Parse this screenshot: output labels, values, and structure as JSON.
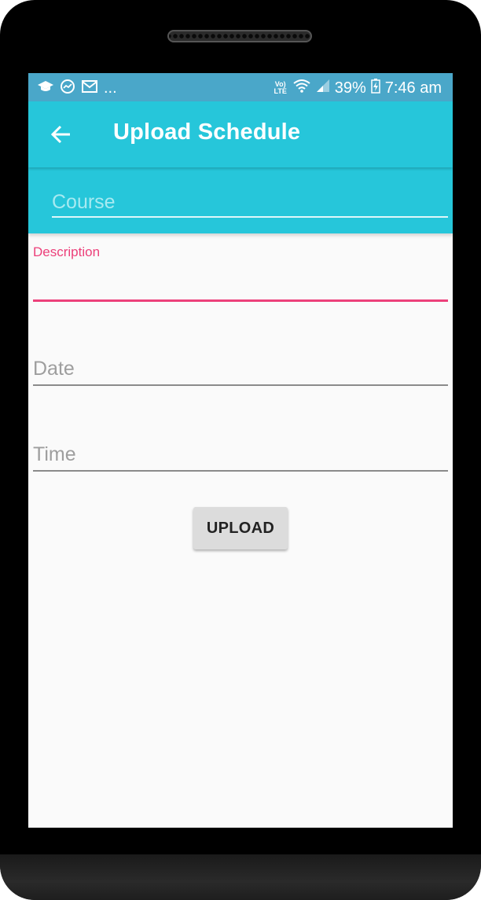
{
  "status_bar": {
    "notification_icons": [
      "graduation-cap-icon",
      "activity-icon",
      "gmail-icon"
    ],
    "more_label": "...",
    "network_label": "Vo) LTE",
    "battery_percent": "39%",
    "time": "7:46 am"
  },
  "app_bar": {
    "title": "Upload Schedule",
    "back_icon": "arrow-back-icon"
  },
  "form": {
    "course_placeholder": "Course",
    "course_value": "",
    "description_label": "Description",
    "description_value": "",
    "date_placeholder": "Date",
    "date_value": "",
    "time_placeholder": "Time",
    "time_value": "",
    "upload_label": "UPLOAD"
  },
  "colors": {
    "status_bar": "#4aa7c9",
    "app_bar": "#26c6da",
    "accent": "#ec407a",
    "background": "#fafafa",
    "button": "#dcdcdc"
  }
}
